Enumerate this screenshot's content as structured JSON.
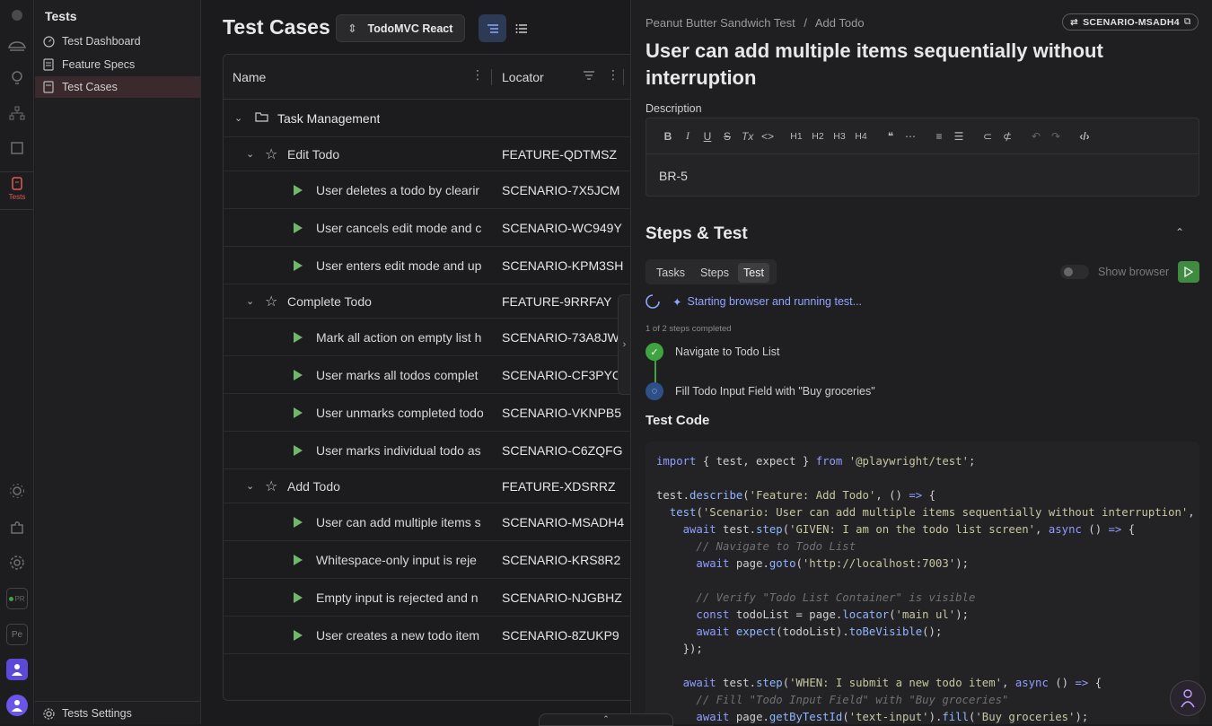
{
  "rail": {
    "tests_label": "Tests",
    "badge_pr": "PR",
    "badge_pe": "Pe"
  },
  "sidebar": {
    "title": "Tests",
    "items": [
      {
        "label": "Test Dashboard",
        "icon": "dashboard-icon"
      },
      {
        "label": "Feature Specs",
        "icon": "document-icon"
      },
      {
        "label": "Test Cases",
        "icon": "test-cases-icon",
        "active": true
      }
    ],
    "settings_label": "Tests Settings"
  },
  "main": {
    "title": "Test Cases",
    "project": "TodoMVC React",
    "columns": {
      "name": "Name",
      "locator": "Locator"
    },
    "group": "Task Management",
    "rows": [
      {
        "type": "feature",
        "name": "Edit Todo",
        "locator": "FEATURE-QDTMSZ"
      },
      {
        "type": "scenario",
        "name": "User deletes a todo by clearir",
        "locator": "SCENARIO-7X5JCM"
      },
      {
        "type": "scenario",
        "name": "User cancels edit mode and c",
        "locator": "SCENARIO-WC949Y"
      },
      {
        "type": "scenario",
        "name": "User enters edit mode and up",
        "locator": "SCENARIO-KPM3SH"
      },
      {
        "type": "feature",
        "name": "Complete Todo",
        "locator": "FEATURE-9RRFAY"
      },
      {
        "type": "scenario",
        "name": "Mark all action on empty list h",
        "locator": "SCENARIO-73A8JW"
      },
      {
        "type": "scenario",
        "name": "User marks all todos complet",
        "locator": "SCENARIO-CF3PYC"
      },
      {
        "type": "scenario",
        "name": "User unmarks completed todo",
        "locator": "SCENARIO-VKNPB5"
      },
      {
        "type": "scenario",
        "name": "User marks individual todo as",
        "locator": "SCENARIO-C6ZQFG"
      },
      {
        "type": "feature",
        "name": "Add Todo",
        "locator": "FEATURE-XDSRRZ"
      },
      {
        "type": "scenario",
        "name": "User can add multiple items s",
        "locator": "SCENARIO-MSADH4"
      },
      {
        "type": "scenario",
        "name": "Whitespace-only input is reje",
        "locator": "SCENARIO-KRS8R2"
      },
      {
        "type": "scenario",
        "name": "Empty input is rejected and n",
        "locator": "SCENARIO-NJGBHZ"
      },
      {
        "type": "scenario",
        "name": "User creates a new todo item",
        "locator": "SCENARIO-8ZUKP9"
      }
    ]
  },
  "detail": {
    "breadcrumb_1": "Peanut Butter Sandwich Test",
    "breadcrumb_sep": "/",
    "breadcrumb_2": "Add Todo",
    "badge": "SCENARIO-MSADH4",
    "title": "User can add multiple items sequentially without interruption",
    "description_label": "Description",
    "description_text": "BR-5",
    "toolbar": [
      "B",
      "I",
      "U",
      "S",
      "Tx",
      "<>",
      "H1",
      "H2",
      "H3",
      "H4"
    ],
    "section_title": "Steps & Test",
    "tabs": [
      "Tasks",
      "Steps",
      "Test"
    ],
    "active_tab": "Test",
    "show_browser": "Show browser",
    "status": "Starting browser and running test...",
    "progress": "1 of 2 steps completed",
    "steps": [
      {
        "label": "Navigate to Todo List",
        "state": "done"
      },
      {
        "label": "Fill Todo Input Field with \"Buy groceries\"",
        "state": "running"
      }
    ],
    "code_title": "Test Code"
  },
  "colors": {
    "accent": "#7c9cff",
    "success": "#3fa33f",
    "active_nav": "#3a2a2d"
  }
}
